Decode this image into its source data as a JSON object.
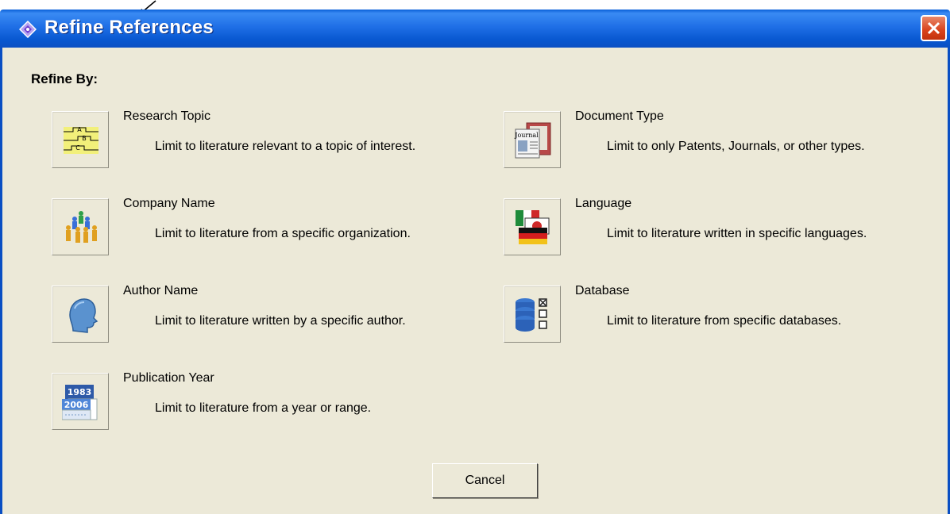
{
  "window": {
    "title": "Refine References",
    "close_icon": "close-icon"
  },
  "heading": "Refine By:",
  "options": [
    {
      "icon": "research-topic-icon",
      "title": "Research Topic",
      "description": "Limit to literature relevant to a topic of interest."
    },
    {
      "icon": "company-name-icon",
      "title": "Company Name",
      "description": "Limit to literature from a specific organization."
    },
    {
      "icon": "author-name-icon",
      "title": "Author Name",
      "description": "Limit to literature written by a specific author."
    },
    {
      "icon": "publication-year-icon",
      "title": "Publication Year",
      "description": "Limit to literature from a year or range."
    },
    {
      "icon": "document-type-icon",
      "title": "Document Type",
      "description": "Limit to only Patents, Journals, or other types."
    },
    {
      "icon": "language-icon",
      "title": "Language",
      "description": "Limit to literature written in specific languages."
    },
    {
      "icon": "database-icon",
      "title": "Database",
      "description": "Limit to literature from specific databases."
    }
  ],
  "icon_text": {
    "topic_letters": [
      "A",
      "B",
      "C"
    ],
    "journal_label": "Journal",
    "years": [
      "1983",
      "2006"
    ]
  },
  "cancel_label": "Cancel",
  "colors": {
    "titlebar": "#0a5fd8",
    "dialog_background": "#ece9d8",
    "close_button": "#d9431c"
  }
}
